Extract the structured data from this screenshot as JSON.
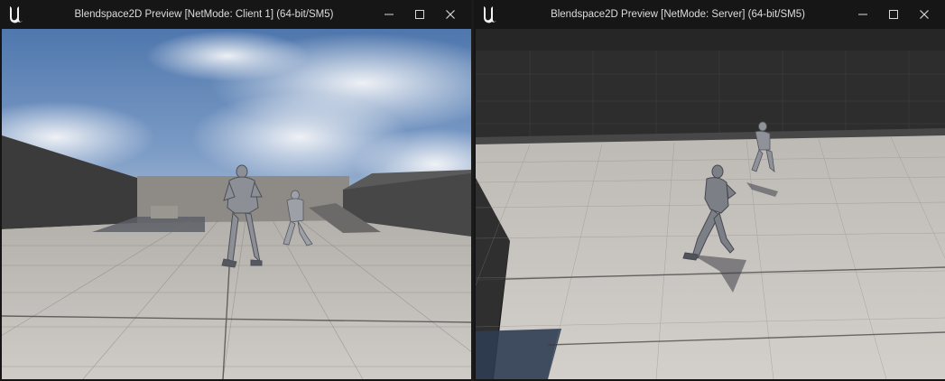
{
  "windows": [
    {
      "title": "Blendspace2D Preview [NetMode: Client 1]  (64-bit/SM5)",
      "logo_icon": "unreal-engine-logo-icon",
      "buttons": {
        "minimize": "minimize-icon",
        "maximize": "maximize-icon",
        "close": "close-icon"
      }
    },
    {
      "title": "Blendspace2D Preview [NetMode: Server]  (64-bit/SM5)",
      "logo_icon": "unreal-engine-logo-icon",
      "buttons": {
        "minimize": "minimize-icon",
        "maximize": "maximize-icon",
        "close": "close-icon"
      }
    }
  ],
  "colors": {
    "titlebar": "#161616",
    "title_text": "#dcdcdc",
    "sky": "#6f93c2",
    "floor": "#c9c5c0",
    "wall": "#3a3a3a"
  }
}
